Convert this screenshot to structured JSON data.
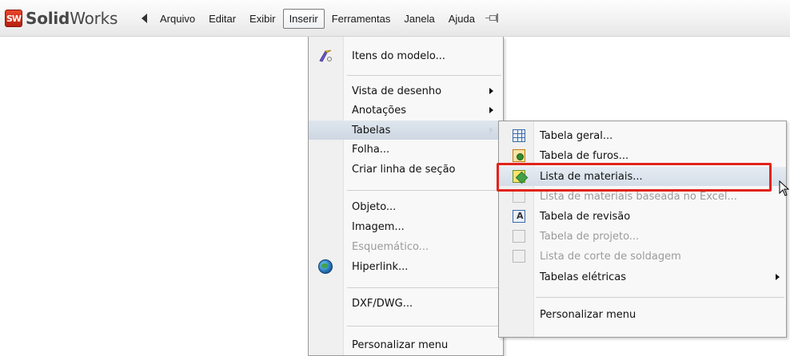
{
  "app": {
    "logo_badge": "SW",
    "logo_text_bold": "Solid",
    "logo_text_regular": "Works"
  },
  "menubar": {
    "items": [
      "Arquivo",
      "Editar",
      "Exibir",
      "Inserir",
      "Ferramentas",
      "Janela",
      "Ajuda"
    ],
    "active_item": "Inserir"
  },
  "insert_menu": {
    "items": [
      {
        "label": "Itens do modelo...",
        "icon": "model-items-icon"
      },
      {
        "label": "Vista de desenho",
        "submenu": true
      },
      {
        "label": "Anotações",
        "submenu": true
      },
      {
        "label": "Tabelas",
        "submenu": true,
        "highlighted": true
      },
      {
        "label": "Folha..."
      },
      {
        "label": "Criar linha de seção"
      },
      {
        "label": "Objeto..."
      },
      {
        "label": "Imagem..."
      },
      {
        "label": "Esquemático...",
        "disabled": true
      },
      {
        "label": "Hiperlink...",
        "icon": "globe-icon"
      },
      {
        "label": "DXF/DWG..."
      },
      {
        "label": "Personalizar menu"
      }
    ]
  },
  "tables_submenu": {
    "items": [
      {
        "label": "Tabela geral...",
        "icon": "general-table-icon"
      },
      {
        "label": "Tabela de furos...",
        "icon": "hole-table-icon"
      },
      {
        "label": "Lista de materiais...",
        "icon": "bom-icon",
        "selected": true
      },
      {
        "label": "Lista de materiais baseada no Excel...",
        "icon": "excel-bom-icon",
        "disabled": true
      },
      {
        "label": "Tabela de revisão",
        "icon": "revision-table-icon"
      },
      {
        "label": "Tabela de projeto...",
        "icon": "design-table-icon",
        "disabled": true
      },
      {
        "label": "Lista de corte de soldagem",
        "icon": "weldment-cut-list-icon",
        "disabled": true
      },
      {
        "label": "Tabelas elétricas",
        "submenu": true
      },
      {
        "label": "Personalizar menu"
      }
    ]
  },
  "colors": {
    "highlight_box": "#e2231a",
    "menu_background": "#f8f8f8",
    "disabled_text": "#9b9b9b"
  }
}
